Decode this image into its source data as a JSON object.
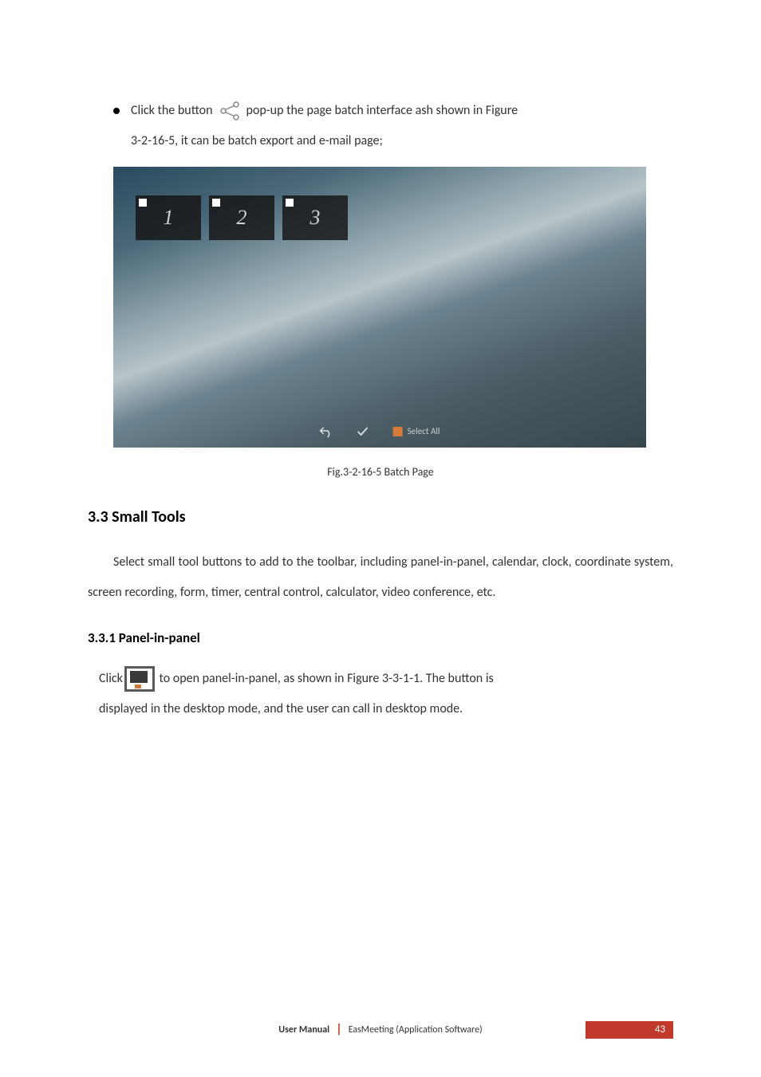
{
  "bullet": {
    "pre": "Click the button",
    "icon_name": "scissor-share-icon",
    "post": "pop-up the page batch interface ash shown in Figure",
    "cont": "3-2-16-5, it can be batch export and e-mail page;"
  },
  "screenshot": {
    "thumbs": [
      "1",
      "2",
      "3"
    ],
    "toolbar": {
      "undo": "↶",
      "check": "✓",
      "select_all": "Select All"
    }
  },
  "caption": "Fig.3-2-16-5 Batch Page",
  "h2": "3.3 Small Tools",
  "p1": "Select small tool buttons to add to the toolbar, including panel-in-panel, calendar, clock, coordinate system, screen recording, form, timer, central control, calculator, video conference, etc.",
  "h3": "3.3.1 Panel-in-panel",
  "p2": {
    "pre": "Click",
    "icon_name": "panel-in-panel-icon",
    "post": "to open panel-in-panel, as shown in Figure 3-3-1-1. The button is",
    "line2": "displayed in the desktop mode, and the user can call in desktop mode."
  },
  "footer": {
    "label": "User Manual",
    "product": "EasMeeting (Application Software)",
    "page": "43"
  }
}
